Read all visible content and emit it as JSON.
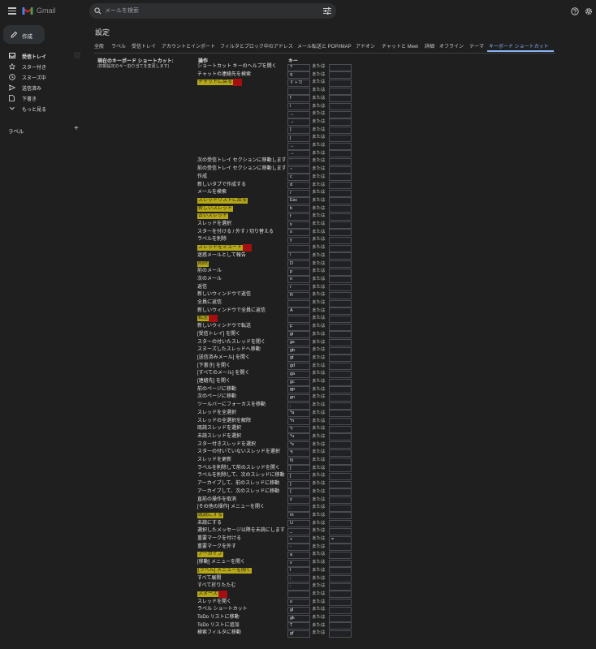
{
  "app": {
    "name": "Gmail"
  },
  "colors": {
    "highlight": "#b6a716",
    "red_marker": "#a50f0f",
    "accent": "#8ab4f8"
  },
  "search": {
    "placeholder": "メールを検索"
  },
  "sidebar": {
    "compose_label": "作成",
    "items": [
      {
        "label": "受信トレイ",
        "icon": "inbox-icon"
      },
      {
        "label": "スター付き",
        "icon": "star-icon"
      },
      {
        "label": "スヌーズ中",
        "icon": "clock-icon"
      },
      {
        "label": "送信済み",
        "icon": "send-icon"
      },
      {
        "label": "下書き",
        "icon": "draft-icon"
      },
      {
        "label": "もっと見る",
        "icon": "chevron-down-icon"
      }
    ],
    "labels_title": "ラベル",
    "labels_add": "+"
  },
  "settings": {
    "title": "設定",
    "tabs": [
      "全般",
      "ラベル",
      "受信トレイ",
      "アカウントとインポート",
      "フィルタとブロック中のアドレス",
      "メール転送と POP/IMAP",
      "アドオン",
      "チャットと Meet",
      "詳細",
      "オフライン",
      "テーマ",
      "キーボード ショートカット"
    ],
    "active_tab": "キーボード ショートカット",
    "current_title": "現在のキーボード ショートカット:",
    "current_sub": "(初期設定のキー割り当てを変更します)",
    "col_action": "操作",
    "col_key": "キー",
    "or_text": "または"
  },
  "shortcuts": [
    {
      "action": "ショートカット キーのヘルプを開く",
      "key": "?"
    },
    {
      "action": "チャットの連絡先を検索",
      "key": "q"
    },
    {
      "action": "チャットに戻る",
      "key": "⇧ + ⎋",
      "hl": true,
      "red": true
    },
    {
      "action": "",
      "key": ""
    },
    {
      "action": "",
      "key": "f"
    },
    {
      "action": "",
      "key": "i"
    },
    {
      "action": "",
      "key": "←"
    },
    {
      "action": "",
      "key": "→"
    },
    {
      "action": "",
      "key": "]"
    },
    {
      "action": "",
      "key": "j"
    },
    {
      "action": "",
      "key": "←"
    },
    {
      "action": "",
      "key": "→"
    },
    {
      "action": "次の受信トレイ セクションに移動します",
      "key": "`"
    },
    {
      "action": "前の受信トレイ セクションに移動します",
      "key": "~"
    },
    {
      "action": "作成",
      "key": "c"
    },
    {
      "action": "新しいタブで作成する",
      "key": "d"
    },
    {
      "action": "メールを検索",
      "key": "/"
    },
    {
      "action": "スレッドリストに戻る",
      "key": "Esc",
      "hl": true
    },
    {
      "action": "新しいスレッド",
      "key": "b",
      "hl": true
    },
    {
      "action": "古いスレッド",
      "key": "f",
      "hl": true
    },
    {
      "action": "スレッドを選択",
      "key": "x"
    },
    {
      "action": "スターを付ける / 外す / 切り替える",
      "key": "s"
    },
    {
      "action": "ラベルを削除",
      "key": "y"
    },
    {
      "action": "スレッドをミュート",
      "key": "",
      "hl": true,
      "red": true
    },
    {
      "action": "迷惑メールとして報告",
      "key": "!"
    },
    {
      "action": "削除",
      "key": "D",
      "hl": true
    },
    {
      "action": "前のメール",
      "key": "p"
    },
    {
      "action": "次のメール",
      "key": "n"
    },
    {
      "action": "返信",
      "key": "r"
    },
    {
      "action": "新しいウィンドウで返信",
      "key": "R"
    },
    {
      "action": "全員に返信",
      "key": ""
    },
    {
      "action": "新しいウィンドウで全員に返信",
      "key": "A"
    },
    {
      "action": "転送",
      "key": "",
      "hl": true,
      "red": true
    },
    {
      "action": "新しいウィンドウで転送",
      "key": "F"
    },
    {
      "action": "[受信トレイ] を開く",
      "key": "gi"
    },
    {
      "action": "スターの付いたスレッドを開く",
      "key": "gs"
    },
    {
      "action": "スヌーズしたスレッドへ移動",
      "key": "gb"
    },
    {
      "action": "[送信済みメール] を開く",
      "key": "gt"
    },
    {
      "action": "[下書き] を開く",
      "key": "gd"
    },
    {
      "action": "[すべてのメール] を開く",
      "key": "ga"
    },
    {
      "action": "[連絡先] を開く",
      "key": "gc"
    },
    {
      "action": "前のページに移動",
      "key": "gp"
    },
    {
      "action": "次のページに移動",
      "key": "gn"
    },
    {
      "action": "ツールバーにフォーカスを移動",
      "key": ","
    },
    {
      "action": "スレッドを全選択",
      "key": "*a"
    },
    {
      "action": "スレッドの全選択を解除",
      "key": "*n"
    },
    {
      "action": "既読スレッドを選択",
      "key": "*r"
    },
    {
      "action": "未読スレッドを選択",
      "key": "*u"
    },
    {
      "action": "スター付きスレッドを選択",
      "key": "*s"
    },
    {
      "action": "スターの付いていないスレッドを選択",
      "key": "*t"
    },
    {
      "action": "スレッドを更新",
      "key": "N"
    },
    {
      "action": "ラベルを削除して前のスレッドを開く",
      "key": "]"
    },
    {
      "action": "ラベルを削除して、次のスレッドに移動",
      "key": "["
    },
    {
      "action": "アーカイブして、前のスレッドに移動",
      "key": "}"
    },
    {
      "action": "アーカイブして、次のスレッドに移動",
      "key": "{"
    },
    {
      "action": "直前の操作を取消",
      "key": "z"
    },
    {
      "action": "[その他の操作] メニューを開く",
      "key": "."
    },
    {
      "action": "既読にする",
      "key": "m",
      "hl": true
    },
    {
      "action": "未読にする",
      "key": "U"
    },
    {
      "action": "選択したメッセージ以降を未読にします",
      "key": "_"
    },
    {
      "action": "重要マークを付ける",
      "key": "+",
      "key2": "="
    },
    {
      "action": "重要マークを外す",
      "key": "-"
    },
    {
      "action": "アーカイブ",
      "key": "a",
      "hl": true
    },
    {
      "action": "[移動] メニューを開く",
      "key": "v"
    },
    {
      "action": "[ラベル] メニューを開く",
      "key": "l",
      "hl": true
    },
    {
      "action": "すべて展開",
      "key": ";"
    },
    {
      "action": "すべて折りたたむ",
      "key": ":"
    },
    {
      "action": "スヌーズ",
      "key": "",
      "hl": true,
      "red": true
    },
    {
      "action": "スレッドを開く",
      "key": "o"
    },
    {
      "action": "ラベル ショートカット",
      "key": "gl"
    },
    {
      "action": "ToDo リストに移動",
      "key": "gk"
    },
    {
      "action": "ToDo リストに追加",
      "key": "T"
    },
    {
      "action": "検索フィルタに移動",
      "key": "gf"
    }
  ]
}
